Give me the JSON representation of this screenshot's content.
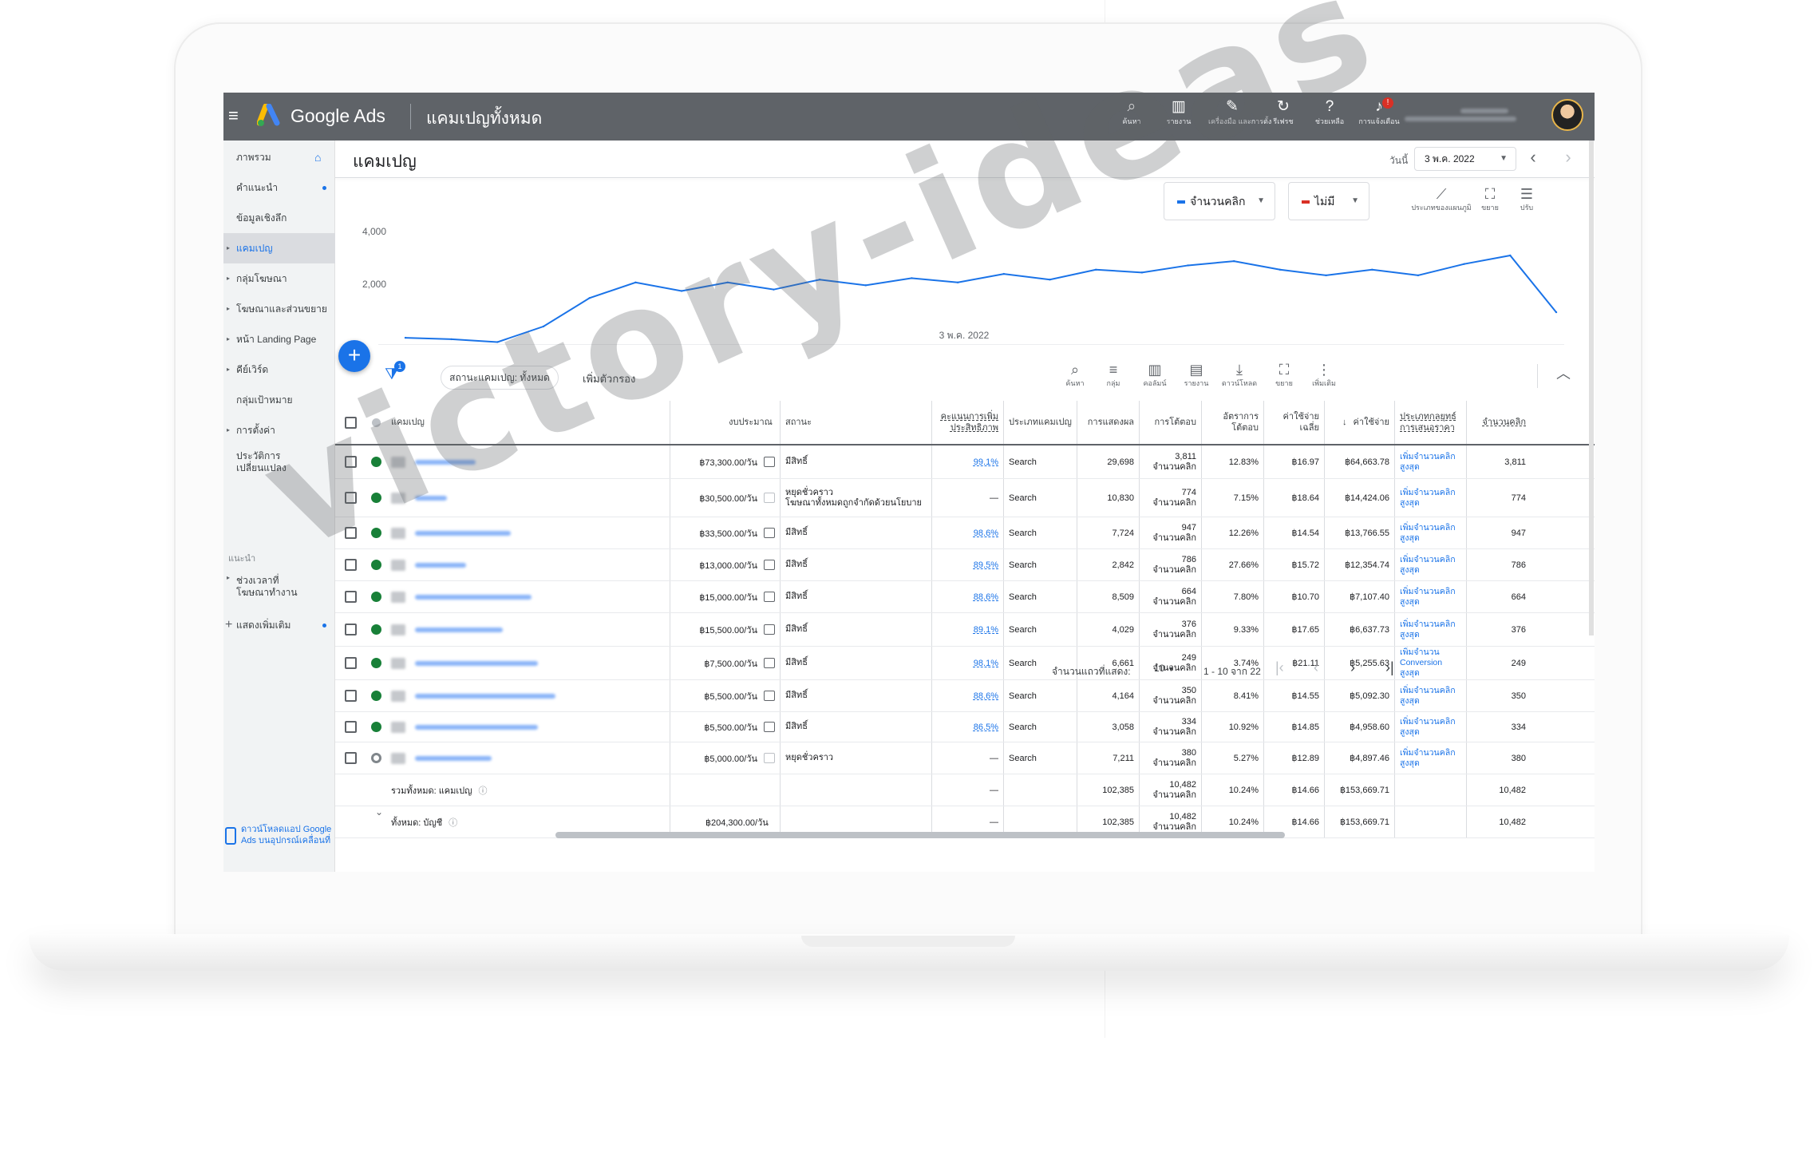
{
  "app": {
    "brand": "Google Ads",
    "page_title": "แคมเปญทั้งหมด"
  },
  "topbar": {
    "tools": [
      {
        "icon": "search-icon",
        "label": "ค้นหา"
      },
      {
        "icon": "report-icon",
        "label": "รายงาน"
      },
      {
        "icon": "wrench-icon",
        "label": "เครื่องมือ และการตั้ง"
      },
      {
        "icon": "refresh-icon",
        "label": "รีเฟรช"
      },
      {
        "icon": "help-icon",
        "label": "ช่วยเหลือ"
      },
      {
        "icon": "bell-icon",
        "label": "การแจ้งเตือน",
        "badge": "!"
      }
    ]
  },
  "sidebar": {
    "items": [
      {
        "label": "ภาพรวม"
      },
      {
        "label": "คำแนะนำ"
      },
      {
        "label": "ข้อมูลเชิงลึก"
      },
      {
        "label": "แคมเปญ"
      },
      {
        "label": "กลุ่มโฆษณา"
      },
      {
        "label": "โฆษณาและส่วนขยาย"
      },
      {
        "label": "หน้า Landing Page"
      },
      {
        "label": "คีย์เวิร์ด"
      },
      {
        "label": "กลุ่มเป้าหมาย"
      },
      {
        "label": "การตั้งค่า"
      },
      {
        "label": "ประวัติการเปลี่ยนแปลง"
      }
    ],
    "section_label": "แนะนำ",
    "suggested": {
      "label": "ช่วงเวลาที่โฆษณาทำงาน"
    },
    "show_more": "แสดงเพิ่มเติม",
    "download_app": "ดาวน์โหลดแอป Google Ads บนอุปกรณ์เคลื่อนที่"
  },
  "main": {
    "title": "แคมเปญ",
    "date_label": "วันนี้",
    "date_value": "3 พ.ค. 2022"
  },
  "chart_data": {
    "type": "line",
    "metric_1": "จำนวนคลิก",
    "metric_2": "ไม่มี",
    "x_label": "3 พ.ค. 2022",
    "ytick_labels": [
      "4,000",
      "2,000"
    ],
    "ylim": [
      0,
      4500
    ],
    "values": [
      250,
      200,
      100,
      650,
      1650,
      2200,
      1900,
      2200,
      1950,
      2300,
      2100,
      2350,
      2200,
      2500,
      2300,
      2650,
      2550,
      2800,
      2950,
      2650,
      2450,
      2650,
      2450,
      2850,
      3150,
      1150
    ],
    "tools": [
      {
        "icon": "line-chart-icon",
        "label": "ประเภทของแผนภูมิ"
      },
      {
        "icon": "expand-icon",
        "label": "ขยาย"
      },
      {
        "icon": "tune-icon",
        "label": "ปรับ"
      }
    ]
  },
  "filter": {
    "badge": "1",
    "chip": "สถานะแคมเปญ: ทั้งหมด",
    "add": "เพิ่มตัวกรอง"
  },
  "table_tools": [
    {
      "icon": "search-icon",
      "label": "ค้นหา"
    },
    {
      "icon": "segment-icon",
      "label": "กลุ่ม"
    },
    {
      "icon": "columns-icon",
      "label": "คอลัมน์"
    },
    {
      "icon": "report-icon",
      "label": "รายงาน"
    },
    {
      "icon": "download-icon",
      "label": "ดาวน์โหลด"
    },
    {
      "icon": "expand-icon",
      "label": "ขยาย"
    },
    {
      "icon": "more-icon",
      "label": "เพิ่มเติม"
    }
  ],
  "columns": {
    "campaign": "แคมเปญ",
    "budget": "งบประมาณ",
    "status": "สถานะ",
    "opt_score": "คะแนนการเพิ่มประสิทธิภาพ",
    "type": "ประเภทแคมเปญ",
    "impr": "การแสดงผล",
    "interactions": "การโต้ตอบ",
    "int_rate": "อัตราการโต้ตอบ",
    "avg_cost": "ค่าใช้จ่ายเฉลี่ย",
    "cost": "ค่าใช้จ่าย",
    "bid_strategy": "ประเภทกลยุทธ์การเสนอราคา",
    "clicks": "จำนวนคลิก"
  },
  "rows": [
    {
      "status_dot": "green",
      "name_width": 76,
      "budget": "฿73,300.00/วัน",
      "status": "มีสิทธิ์",
      "status2": "",
      "opt": "99.1%",
      "type": "Search",
      "impr": "29,698",
      "inter": "3,811",
      "inter_unit": "จำนวนคลิก",
      "rate": "12.83%",
      "avg": "฿16.97",
      "cost": "฿64,663.78",
      "bid1": "เพิ่มจำนวนคลิก",
      "bid2": "สูงสุด",
      "bid3": "",
      "clicks": "3,811"
    },
    {
      "status_dot": "green",
      "name_width": 40,
      "budget": "฿30,500.00/วัน",
      "status": "หยุดชั่วคราว",
      "status2": "โฆษณาทั้งหมดถูกจำกัดด้วยนโยบาย",
      "opt": "—",
      "type": "Search",
      "impr": "10,830",
      "inter": "774",
      "inter_unit": "จำนวนคลิก",
      "rate": "7.15%",
      "avg": "฿18.64",
      "cost": "฿14,424.06",
      "bid1": "เพิ่มจำนวนคลิก",
      "bid2": "สูงสุด",
      "bid3": "",
      "clicks": "774"
    },
    {
      "status_dot": "green",
      "name_width": 120,
      "budget": "฿33,500.00/วัน",
      "status": "มีสิทธิ์",
      "status2": "",
      "opt": "98.6%",
      "type": "Search",
      "impr": "7,724",
      "inter": "947",
      "inter_unit": "จำนวนคลิก",
      "rate": "12.26%",
      "avg": "฿14.54",
      "cost": "฿13,766.55",
      "bid1": "เพิ่มจำนวนคลิก",
      "bid2": "สูงสุด",
      "bid3": "",
      "clicks": "947"
    },
    {
      "status_dot": "green",
      "name_width": 64,
      "budget": "฿13,000.00/วัน",
      "status": "มีสิทธิ์",
      "status2": "",
      "opt": "89.5%",
      "type": "Search",
      "impr": "2,842",
      "inter": "786",
      "inter_unit": "จำนวนคลิก",
      "rate": "27.66%",
      "avg": "฿15.72",
      "cost": "฿12,354.74",
      "bid1": "เพิ่มจำนวนคลิก",
      "bid2": "สูงสุด",
      "bid3": "",
      "clicks": "786"
    },
    {
      "status_dot": "green",
      "name_width": 146,
      "budget": "฿15,000.00/วัน",
      "status": "มีสิทธิ์",
      "status2": "",
      "opt": "88.6%",
      "type": "Search",
      "impr": "8,509",
      "inter": "664",
      "inter_unit": "จำนวนคลิก",
      "rate": "7.80%",
      "avg": "฿10.70",
      "cost": "฿7,107.40",
      "bid1": "เพิ่มจำนวนคลิก",
      "bid2": "สูงสุด",
      "bid3": "",
      "clicks": "664"
    },
    {
      "status_dot": "green",
      "name_width": 110,
      "budget": "฿15,500.00/วัน",
      "status": "มีสิทธิ์",
      "status2": "",
      "opt": "89.1%",
      "type": "Search",
      "impr": "4,029",
      "inter": "376",
      "inter_unit": "จำนวนคลิก",
      "rate": "9.33%",
      "avg": "฿17.65",
      "cost": "฿6,637.73",
      "bid1": "เพิ่มจำนวนคลิก",
      "bid2": "สูงสุด",
      "bid3": "",
      "clicks": "376"
    },
    {
      "status_dot": "green",
      "name_width": 154,
      "budget": "฿7,500.00/วัน",
      "status": "มีสิทธิ์",
      "status2": "",
      "opt": "98.1%",
      "type": "Search",
      "impr": "6,661",
      "inter": "249",
      "inter_unit": "จำนวนคลิก",
      "rate": "3.74%",
      "avg": "฿21.11",
      "cost": "฿5,255.63",
      "bid1": "เพิ่มจำนวน",
      "bid2": "Conversion",
      "bid3": "สูงสุด",
      "clicks": "249"
    },
    {
      "status_dot": "green",
      "name_width": 176,
      "budget": "฿5,500.00/วัน",
      "status": "มีสิทธิ์",
      "status2": "",
      "opt": "88.6%",
      "type": "Search",
      "impr": "4,164",
      "inter": "350",
      "inter_unit": "จำนวนคลิก",
      "rate": "8.41%",
      "avg": "฿14.55",
      "cost": "฿5,092.30",
      "bid1": "เพิ่มจำนวนคลิก",
      "bid2": "สูงสุด",
      "bid3": "",
      "clicks": "350"
    },
    {
      "status_dot": "green",
      "name_width": 154,
      "budget": "฿5,500.00/วัน",
      "status": "มีสิทธิ์",
      "status2": "",
      "opt": "86.5%",
      "type": "Search",
      "impr": "3,058",
      "inter": "334",
      "inter_unit": "จำนวนคลิก",
      "rate": "10.92%",
      "avg": "฿14.85",
      "cost": "฿4,958.60",
      "bid1": "เพิ่มจำนวนคลิก",
      "bid2": "สูงสุด",
      "bid3": "",
      "clicks": "334"
    },
    {
      "status_dot": "grey",
      "name_width": 96,
      "budget": "฿5,000.00/วัน",
      "status": "หยุดชั่วคราว",
      "status2": "",
      "opt": "—",
      "type": "Search",
      "impr": "7,211",
      "inter": "380",
      "inter_unit": "จำนวนคลิก",
      "rate": "5.27%",
      "avg": "฿12.89",
      "cost": "฿4,897.46",
      "bid1": "เพิ่มจำนวนคลิก",
      "bid2": "สูงสุด",
      "bid3": "",
      "clicks": "380"
    }
  ],
  "totals": [
    {
      "label": "รวมทั้งหมด: แคมเปญ",
      "budget": "",
      "opt": "—",
      "impr": "102,385",
      "inter": "10,482",
      "inter_unit": "จำนวนคลิก",
      "rate": "10.24%",
      "avg": "฿14.66",
      "cost": "฿153,669.71",
      "clicks": "10,482"
    },
    {
      "label": "ทั้งหมด: บัญชี",
      "budget": "฿204,300.00/วัน",
      "opt": "—",
      "impr": "102,385",
      "inter": "10,482",
      "inter_unit": "จำนวนคลิก",
      "rate": "10.24%",
      "avg": "฿14.66",
      "cost": "฿153,669.71",
      "clicks": "10,482"
    }
  ],
  "pager": {
    "rows_label": "จำนวนแถวที่แสดง:",
    "rows_value": "10",
    "range": "1 - 10 จาก 22"
  },
  "watermark": "victory-ideas"
}
